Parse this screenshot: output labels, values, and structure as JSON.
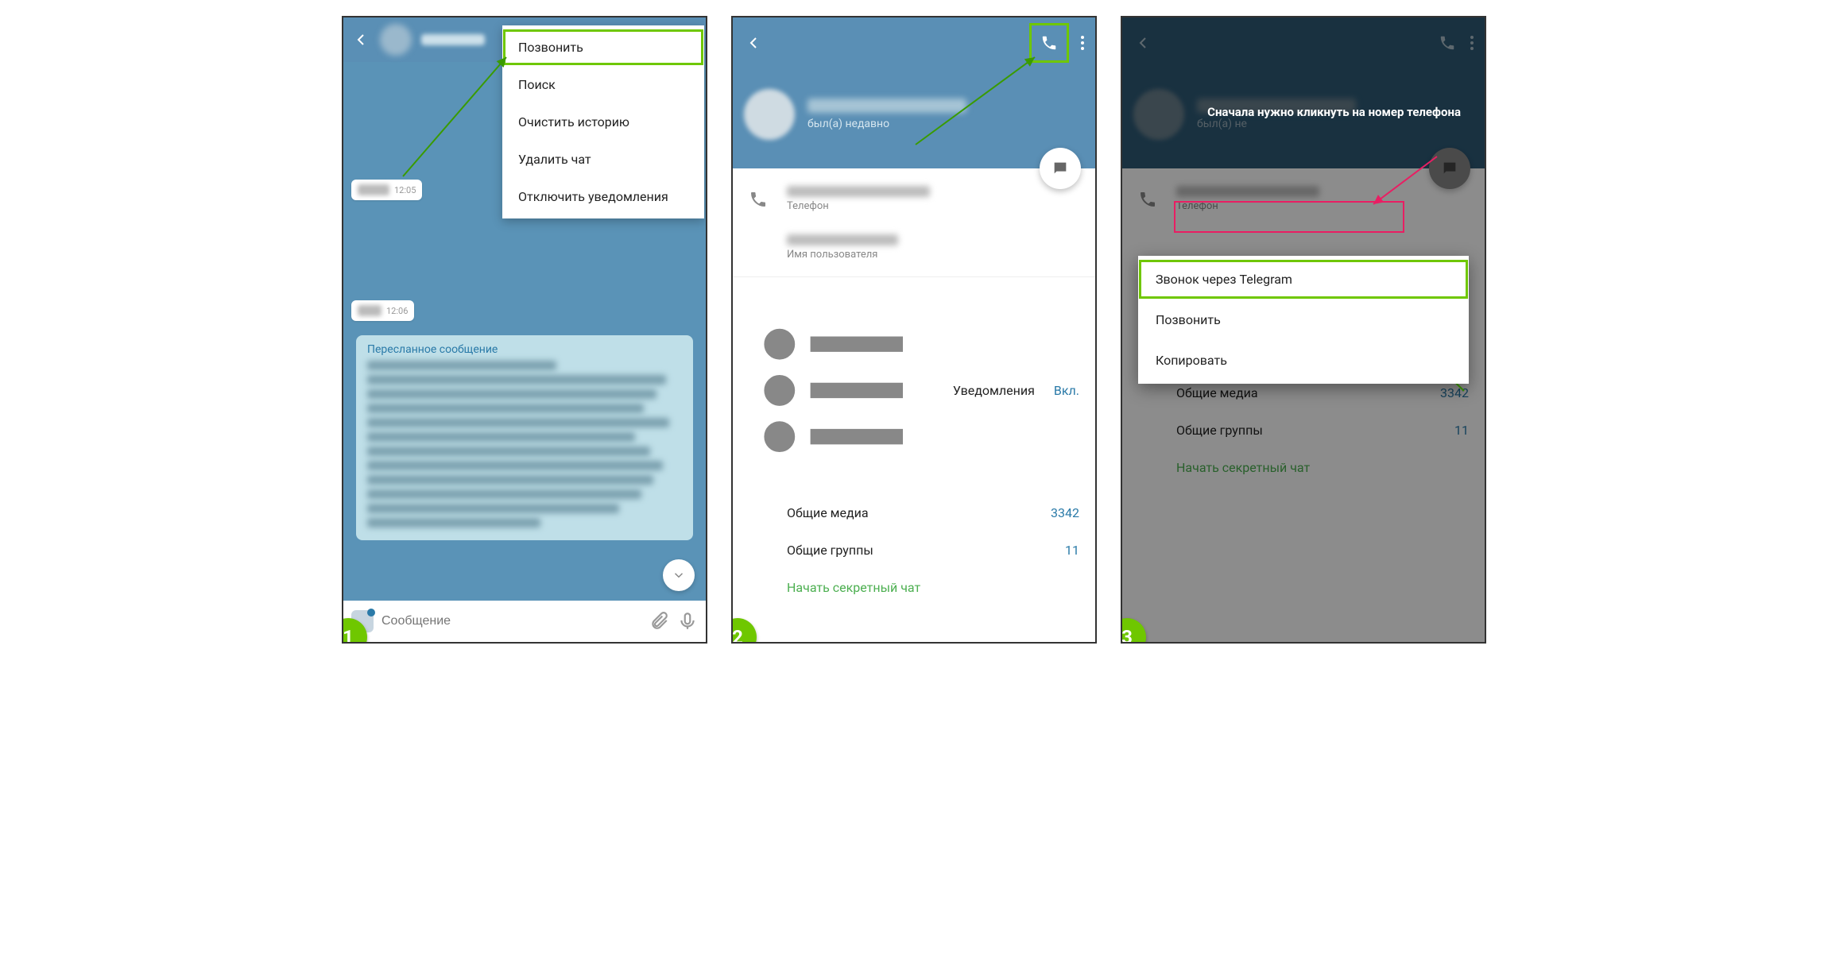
{
  "step_labels": [
    "1",
    "2",
    "3"
  ],
  "panel1": {
    "menu": {
      "call": "Позвонить",
      "search": "Поиск",
      "clear_history": "Очистить историю",
      "delete_chat": "Удалить чат",
      "mute": "Отключить уведомления"
    },
    "messages": {
      "time1": "12:05",
      "time2": "12:06",
      "forwarded_label": "Пересланное сообщение"
    },
    "input": {
      "placeholder": "Сообщение"
    }
  },
  "panel2": {
    "status": "был(а) недавно",
    "phone_label": "Телефон",
    "username_label": "Имя пользователя",
    "notifications": {
      "label": "Уведомления",
      "value": "Вкл."
    },
    "shared_media": {
      "label": "Общие медиа",
      "value": "3342"
    },
    "shared_groups": {
      "label": "Общие группы",
      "value": "11"
    },
    "secret_chat": "Начать секретный чат"
  },
  "panel3": {
    "status": "был(а) не",
    "annotation": "Сначала нужно кликнуть на номер телефона",
    "phone_label": "Телефон",
    "popup": {
      "telegram_call": "Звонок через Telegram",
      "call": "Позвонить",
      "copy": "Копировать"
    },
    "shared_media": {
      "label": "Общие медиа",
      "value": "3342"
    },
    "shared_groups": {
      "label": "Общие группы",
      "value": "11"
    },
    "secret_chat": "Начать секретный чат"
  }
}
